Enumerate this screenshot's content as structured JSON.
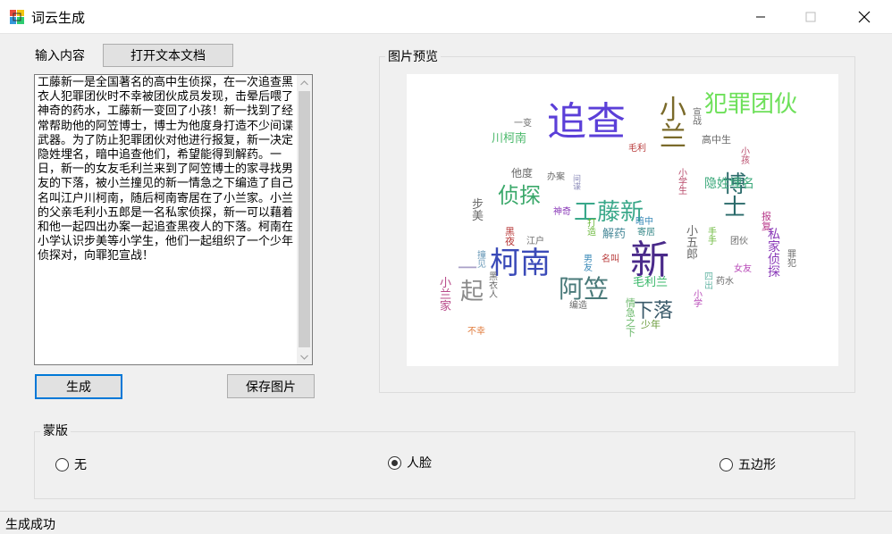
{
  "window": {
    "title": "词云生成",
    "icon": "app-windows-icon"
  },
  "input": {
    "label": "输入内容",
    "open_button": "打开文本文档",
    "text": "工藤新一是全国著名的高中生侦探，在一次追查黑衣人犯罪团伙时不幸被团伙成员发现，击晕后喂了神奇的药水，工藤新一变回了小孩！新一找到了经常帮助他的阿笠博士，博士为他度身打造不少间谍武器。为了防止犯罪团伙对他进行报复，新一决定隐姓埋名，暗中追查他们，希望能得到解药。一日，新一的女友毛利兰来到了阿笠博士的家寻找男友的下落，被小兰撞见的新一情急之下编造了自己名叫江户川柯南，随后柯南寄居在了小兰家。小兰的父亲毛利小五郎是一名私家侦探，新一可以藉着和他一起四出办案一起追查黑夜人的下落。柯南在小学认识步美等小学生，他们一起组织了一个少年侦探对，向罪犯宣战！"
  },
  "buttons": {
    "generate": "生成",
    "save_image": "保存图片"
  },
  "preview": {
    "label": "图片预览",
    "wordcloud": [
      {
        "text": "追查",
        "color": "#5b3fd8"
      },
      {
        "text": "犯罪团伙",
        "color": "#6ee05a"
      },
      {
        "text": "小兰",
        "color": "#7a6a2a"
      },
      {
        "text": "新",
        "color": "#4a2a8a"
      },
      {
        "text": "柯南",
        "color": "#3a4ab8"
      },
      {
        "text": "博士",
        "color": "#2a6a6a"
      },
      {
        "text": "阿笠",
        "color": "#4a7a7a"
      },
      {
        "text": "工藤新",
        "color": "#3aa88a"
      },
      {
        "text": "侦探",
        "color": "#3aa86a"
      },
      {
        "text": "下落",
        "color": "#3a5a6a"
      },
      {
        "text": "起",
        "color": "#8a8a8a"
      },
      {
        "text": "一",
        "color": "#aaa0c8"
      },
      {
        "text": "隐姓埋名",
        "color": "#3aa87a"
      },
      {
        "text": "川柯南",
        "color": "#4ab86a"
      },
      {
        "text": "高中生",
        "color": "#6a6a6a"
      },
      {
        "text": "毛利兰",
        "color": "#3ab86a"
      },
      {
        "text": "解药",
        "color": "#4a8a9a"
      },
      {
        "text": "私家侦探",
        "color": "#8a3ab8"
      },
      {
        "text": "他度",
        "color": "#6a6a6a"
      },
      {
        "text": "小兰家",
        "color": "#b84a8a"
      },
      {
        "text": "小五郎",
        "color": "#6a6a6a"
      },
      {
        "text": "毛利",
        "color": "#b83a3a"
      },
      {
        "text": "一变",
        "color": "#6a6a6a"
      },
      {
        "text": "宣战",
        "color": "#6a6a6a"
      },
      {
        "text": "小孩",
        "color": "#b84a6a"
      },
      {
        "text": "办案",
        "color": "#6a6a6a"
      },
      {
        "text": "神奇",
        "color": "#8a3ab8"
      },
      {
        "text": "步美",
        "color": "#6a6a6a"
      },
      {
        "text": "黑夜",
        "color": "#b83a3a"
      },
      {
        "text": "江户",
        "color": "#6a6a6a"
      },
      {
        "text": "打造",
        "color": "#6ab83a"
      },
      {
        "text": "名叫",
        "color": "#b83a3a"
      },
      {
        "text": "男友",
        "color": "#3a8ab8"
      },
      {
        "text": "撞见",
        "color": "#6a9ab8"
      },
      {
        "text": "黑衣人",
        "color": "#6a6a6a"
      },
      {
        "text": "编造",
        "color": "#6a6a6a"
      },
      {
        "text": "情急之下",
        "color": "#6ab86a"
      },
      {
        "text": "少年",
        "color": "#6a9a3a"
      },
      {
        "text": "不幸",
        "color": "#e07a3a"
      },
      {
        "text": "小学生",
        "color": "#b84a6a"
      },
      {
        "text": "女友",
        "color": "#b84ab8"
      },
      {
        "text": "药水",
        "color": "#6a6a6a"
      },
      {
        "text": "团伙",
        "color": "#6a6a6a"
      },
      {
        "text": "报复",
        "color": "#b83a8a"
      },
      {
        "text": "罪犯",
        "color": "#6a6a6a"
      },
      {
        "text": "四出",
        "color": "#6ab8a8"
      },
      {
        "text": "小学",
        "color": "#b84ab8"
      },
      {
        "text": "暗中",
        "color": "#3a8ab8"
      },
      {
        "text": "寄居",
        "color": "#3a8a8a"
      },
      {
        "text": "手手",
        "color": "#6ab83a"
      },
      {
        "text": "间谍",
        "color": "#8a8ab8"
      }
    ]
  },
  "mask": {
    "label": "蒙版",
    "options": [
      {
        "label": "无",
        "checked": false
      },
      {
        "label": "人脸",
        "checked": true
      },
      {
        "label": "五边形",
        "checked": false
      }
    ]
  },
  "status": {
    "text": "生成成功"
  }
}
